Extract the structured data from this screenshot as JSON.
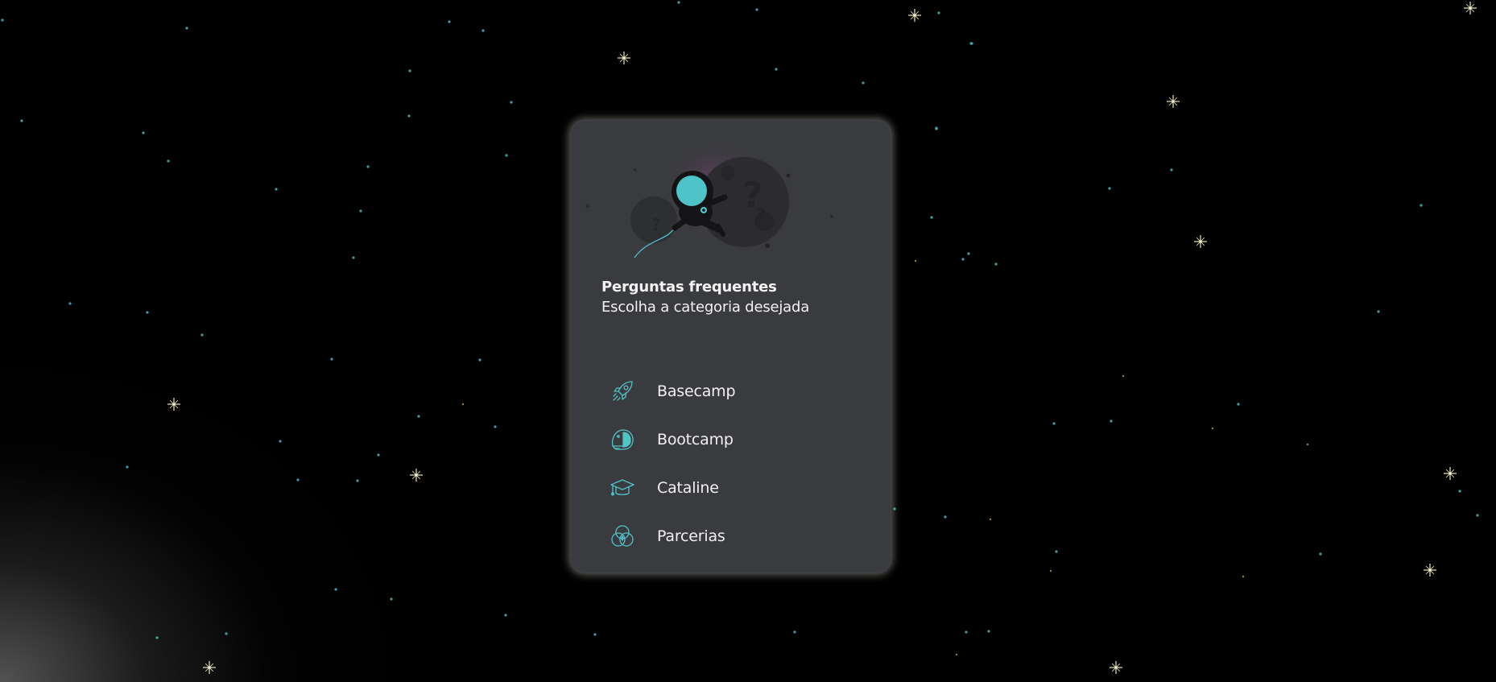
{
  "faq": {
    "title": "Perguntas frequentes",
    "subtitle": "Escolha a categoria desejada"
  },
  "categories": [
    {
      "label": "Basecamp",
      "icon": "rocket-icon"
    },
    {
      "label": "Bootcamp",
      "icon": "astronaut-helmet-icon"
    },
    {
      "label": "Cataline",
      "icon": "graduation-cap-icon"
    },
    {
      "label": "Parcerias",
      "icon": "partnership-circles-icon"
    }
  ],
  "colors": {
    "background": "#000000",
    "card": "#3a3b3f",
    "accent": "#4fc4c8",
    "text": "#f1f1f1",
    "star_cyan": "#4ab8c0",
    "star_gold": "#f0e6b4"
  }
}
